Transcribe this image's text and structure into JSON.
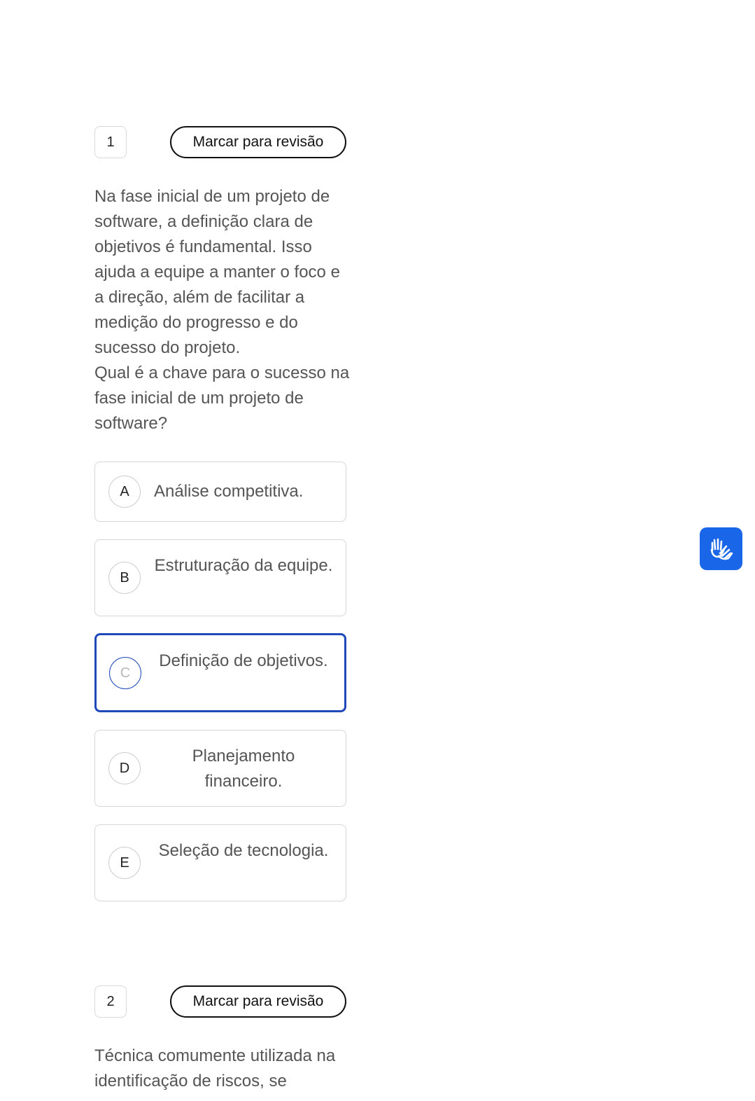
{
  "questions": [
    {
      "number": "1",
      "review_label": "Marcar para revisão",
      "text": "Na fase inicial de um projeto de software, a definição clara de objetivos é fundamental. Isso ajuda a equipe a manter o foco e a direção, além de facilitar a medição do progresso e do sucesso do projeto.",
      "prompt": "Qual é a chave para o sucesso na fase inicial de um projeto de software?",
      "options": [
        {
          "letter": "A",
          "text": "Análise competitiva."
        },
        {
          "letter": "B",
          "text": "Estruturação da equipe."
        },
        {
          "letter": "C",
          "text": "Definição de objetivos.",
          "selected": true
        },
        {
          "letter": "D",
          "text": "Planejamento financeiro."
        },
        {
          "letter": "E",
          "text": "Seleção de tecnologia."
        }
      ]
    },
    {
      "number": "2",
      "review_label": "Marcar para revisão",
      "text": "Técnica comumente utilizada na identificação de riscos, se"
    }
  ],
  "accessibility": {
    "icon": "sign-language-icon",
    "color": "#1a66e8"
  },
  "colors": {
    "selected_border": "#1f49b8",
    "text": "#555555"
  }
}
